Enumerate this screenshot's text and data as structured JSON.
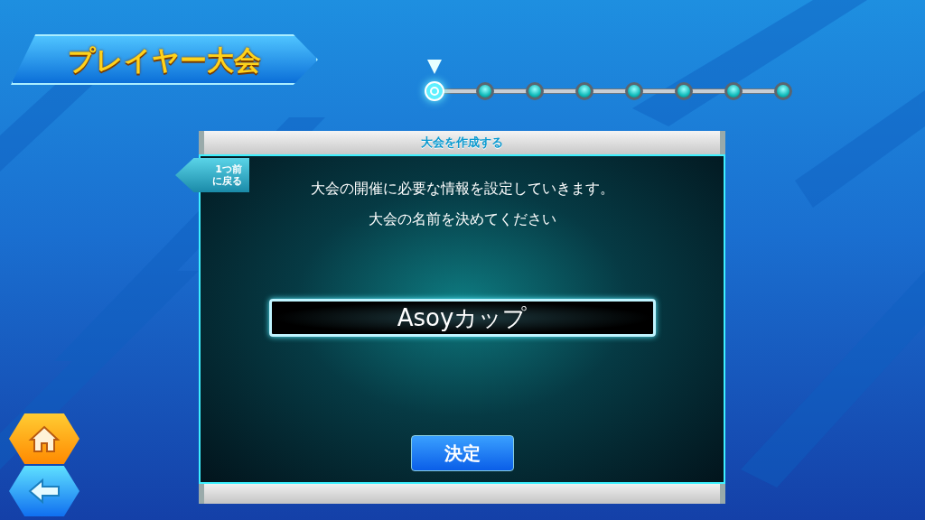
{
  "header": {
    "title": "プレイヤー大会"
  },
  "progress": {
    "steps": [
      {
        "selected": true
      },
      {
        "selected": false
      },
      {
        "selected": false
      },
      {
        "selected": false
      },
      {
        "selected": false
      },
      {
        "selected": false
      },
      {
        "selected": false
      },
      {
        "selected": false
      }
    ]
  },
  "dialog": {
    "title": "大会を作成する",
    "back_button": [
      "1つ前",
      "に戻る"
    ],
    "lines": [
      "大会の開催に必要な情報を設定していきます。",
      "大会の名前を決めてください"
    ],
    "name_field": {
      "value": "Asoyカップ"
    },
    "confirm_button": "決定"
  },
  "nav": [
    {
      "kind": "home"
    },
    {
      "kind": "back"
    }
  ]
}
